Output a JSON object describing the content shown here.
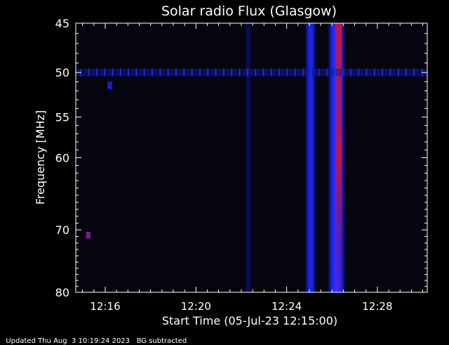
{
  "colors": {
    "background": "#000000",
    "plot_background": "#05050f",
    "axis": "#ffffff",
    "burst_blue": "#1a28ff",
    "burst_red": "#d4142a",
    "faint_band": "#0a1060"
  },
  "chart_data": {
    "type": "heatmap",
    "title": "Solar radio Flux (Glasgow)",
    "xlabel": "Start Time (05-Jul-23 12:15:00)",
    "ylabel": "Frequency [MHz]",
    "xlim_minutes_after_12_15": [
      -0.3,
      15.2
    ],
    "ylim_mhz": [
      45,
      80
    ],
    "y_scale": "log",
    "x_ticks": [
      {
        "minutes": 1,
        "label": "12:16"
      },
      {
        "minutes": 5,
        "label": "12:20"
      },
      {
        "minutes": 9,
        "label": "12:24"
      },
      {
        "minutes": 13,
        "label": "12:28"
      }
    ],
    "y_ticks": [
      {
        "mhz": 45,
        "label": "45"
      },
      {
        "mhz": 50,
        "label": "50"
      },
      {
        "mhz": 55,
        "label": "55"
      },
      {
        "mhz": 60,
        "label": "60"
      },
      {
        "mhz": 70,
        "label": "70"
      },
      {
        "mhz": 80,
        "label": "80"
      }
    ],
    "features": [
      {
        "name": "burst-a",
        "minutes_start": 9.8,
        "minutes_end": 10.3,
        "freq_low": 45,
        "freq_high": 80,
        "intensity": "high"
      },
      {
        "name": "burst-b",
        "minutes_start": 10.8,
        "minutes_end": 11.6,
        "freq_low": 45,
        "freq_high": 80,
        "intensity": "very-high"
      },
      {
        "name": "faint-line",
        "minutes_start": 7.2,
        "minutes_end": 7.4,
        "freq_low": 45,
        "freq_high": 80,
        "intensity": "low"
      },
      {
        "name": "interference-band",
        "minutes_start": -0.3,
        "minutes_end": 15.2,
        "freq_low": 49.6,
        "freq_high": 50.4,
        "intensity": "low"
      },
      {
        "name": "spot-1",
        "minutes_start": 0.15,
        "minutes_end": 0.35,
        "freq_low": 70.3,
        "freq_high": 71.3,
        "intensity": "medium"
      },
      {
        "name": "spot-2",
        "minutes_start": 1.1,
        "minutes_end": 1.3,
        "freq_low": 51.0,
        "freq_high": 51.8,
        "intensity": "low"
      }
    ]
  },
  "footer": {
    "updated": "Updated Thu Aug  3 10:19:24 2023",
    "note": "BG subtracted"
  }
}
